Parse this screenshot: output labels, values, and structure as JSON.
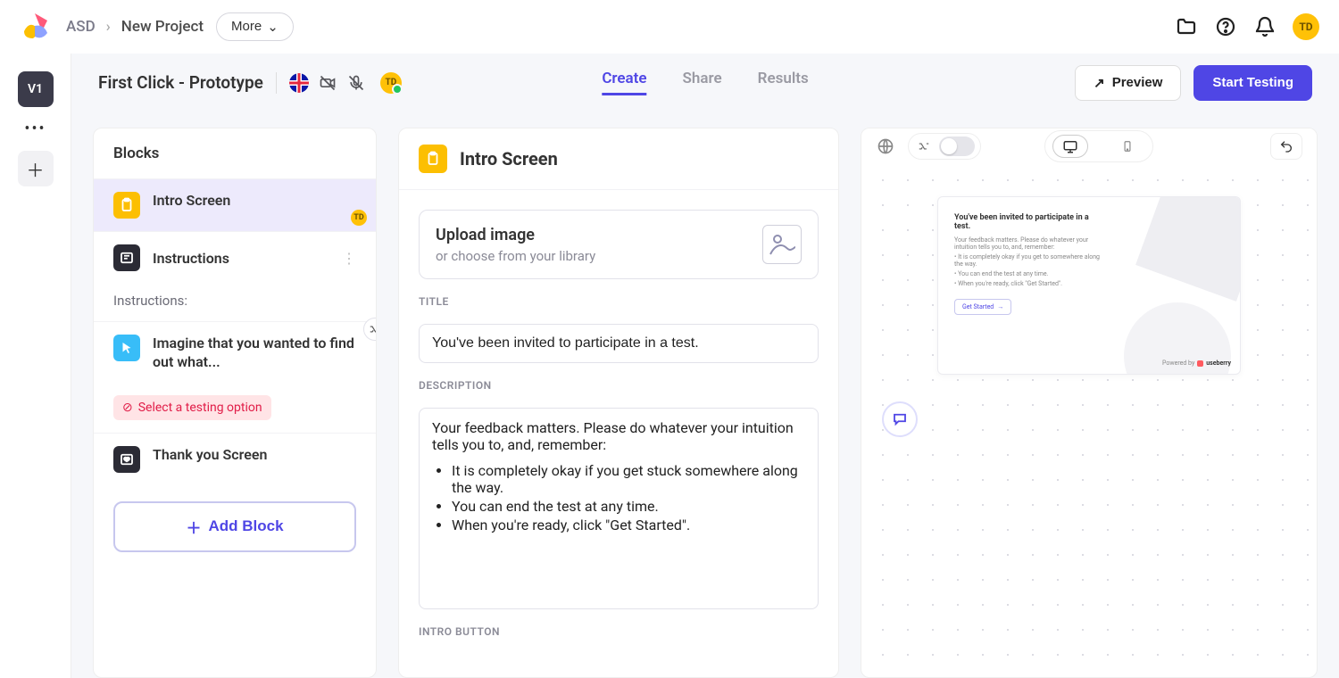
{
  "topbar": {
    "breadcrumbs": [
      "ASD",
      "New Project"
    ],
    "more": "More",
    "avatar": "TD"
  },
  "rail": {
    "version": "V1"
  },
  "header": {
    "title": "First Click - Prototype",
    "avatar": "TD",
    "tabs": {
      "create": "Create",
      "share": "Share",
      "results": "Results"
    },
    "preview": "Preview",
    "start": "Start Testing"
  },
  "blocks": {
    "title": "Blocks",
    "items": [
      {
        "title": "Intro Screen",
        "avatar": "TD"
      },
      {
        "title": "Instructions",
        "sub": "Instructions:"
      },
      {
        "title": "Imagine that you wanted to find out what...",
        "warn": "Select a testing option"
      },
      {
        "title": "Thank you Screen"
      }
    ],
    "add": "Add Block"
  },
  "editor": {
    "panel_title": "Intro Screen",
    "upload": {
      "title": "Upload image",
      "sub": "or choose from your library"
    },
    "title_label": "TITLE",
    "title_value": "You've been invited to participate in a test.",
    "desc_label": "DESCRIPTION",
    "desc_intro": "Your feedback matters. Please do whatever your intuition tells you to, and, remember:",
    "desc_bullets": [
      "It is completely okay if you get stuck somewhere along the way.",
      "You can end the test at any time.",
      "When you're ready, click \"Get Started\"."
    ],
    "intro_button_label": "INTRO BUTTON"
  },
  "preview": {
    "card": {
      "title": "You've been invited to participate in a test.",
      "lines": [
        "Your feedback matters. Please do whatever your intuition tells you to, and, remember:",
        "• It is completely okay if you get to somewhere along the way.",
        "• You can end the test at any time.",
        "• When you're ready, click \"Get Started\"."
      ],
      "button": "Get Started",
      "powered_by": "Powered by",
      "brand": "useberry"
    }
  }
}
